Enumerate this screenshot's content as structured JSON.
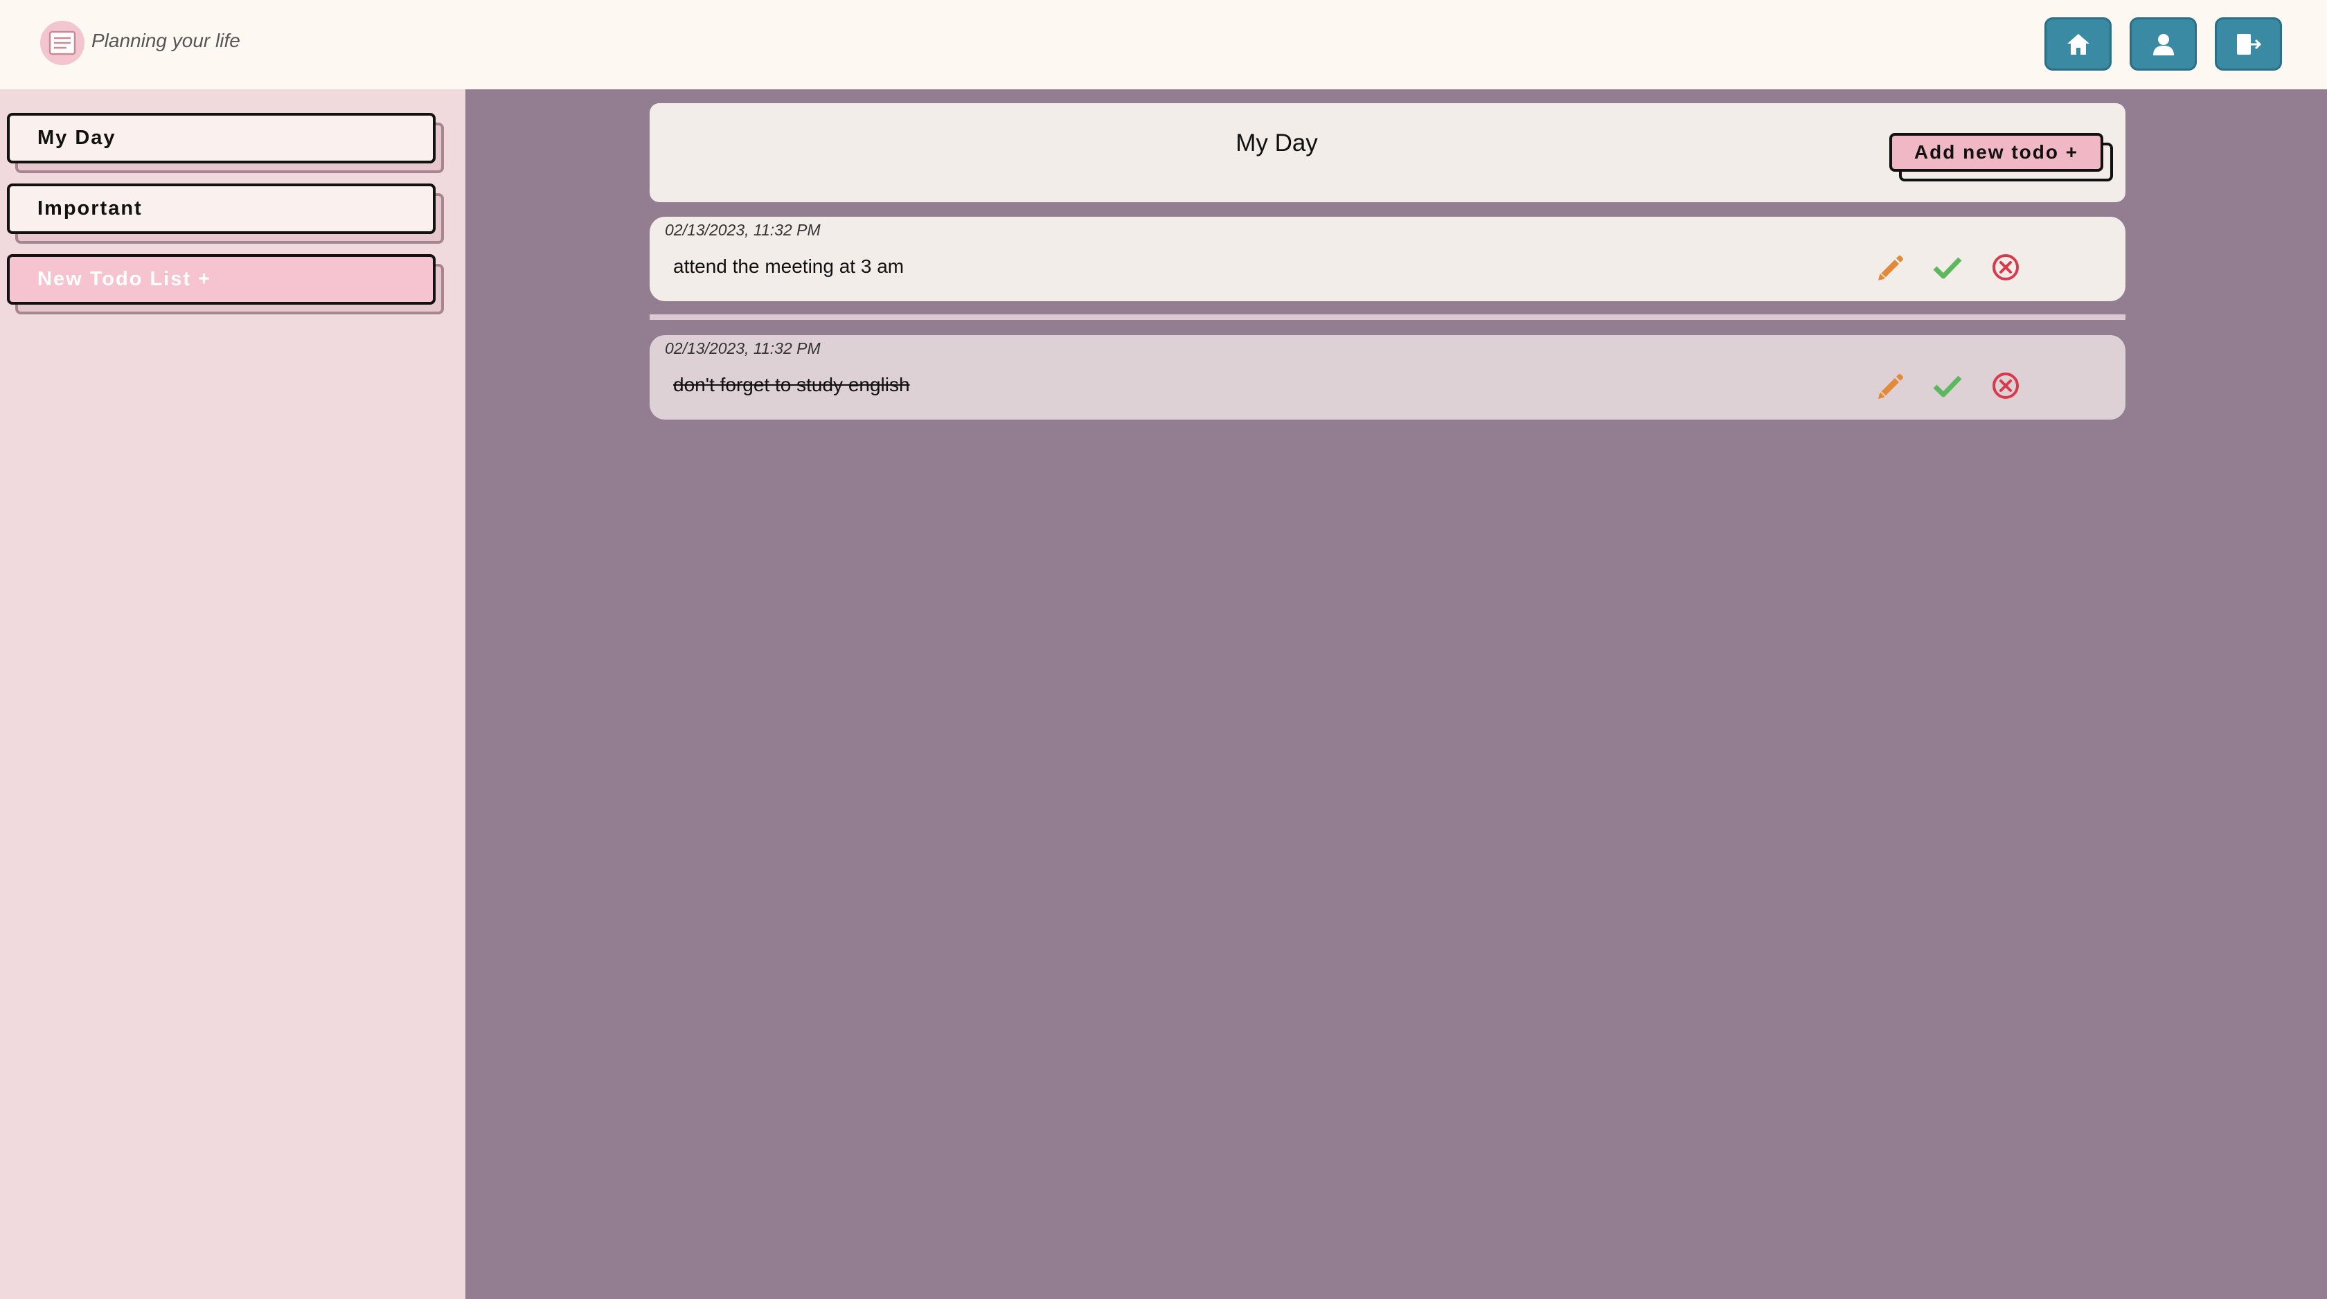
{
  "header": {
    "tagline": "Planning your life",
    "logo_icon": "notepad-logo",
    "nav_buttons": [
      {
        "icon": "home-icon"
      },
      {
        "icon": "user-icon"
      },
      {
        "icon": "logout-icon"
      }
    ]
  },
  "sidebar": {
    "items": [
      {
        "label": "My Day"
      },
      {
        "label": "Important"
      },
      {
        "label": "New Todo List +"
      }
    ]
  },
  "main": {
    "list_title": "My Day",
    "add_button_label": "Add new todo +",
    "todos": [
      {
        "date": "02/13/2023, 11:32 PM",
        "text": "attend the meeting at 3 am",
        "completed": false
      },
      {
        "date": "02/13/2023, 11:32 PM",
        "text": "don't forget to study english",
        "completed": true
      }
    ],
    "action_icons": [
      "pencil-icon",
      "check-icon",
      "circle-x-icon"
    ]
  },
  "colors": {
    "header_bg": "#fdf8f2",
    "sidebar_bg": "#f0dadd",
    "main_bg": "#937e91",
    "nav_button": "#3a8aa3",
    "accent_pink": "#f0b7c5",
    "edit": "#e08a3a",
    "check": "#5cb85c",
    "delete": "#d93a4a"
  }
}
